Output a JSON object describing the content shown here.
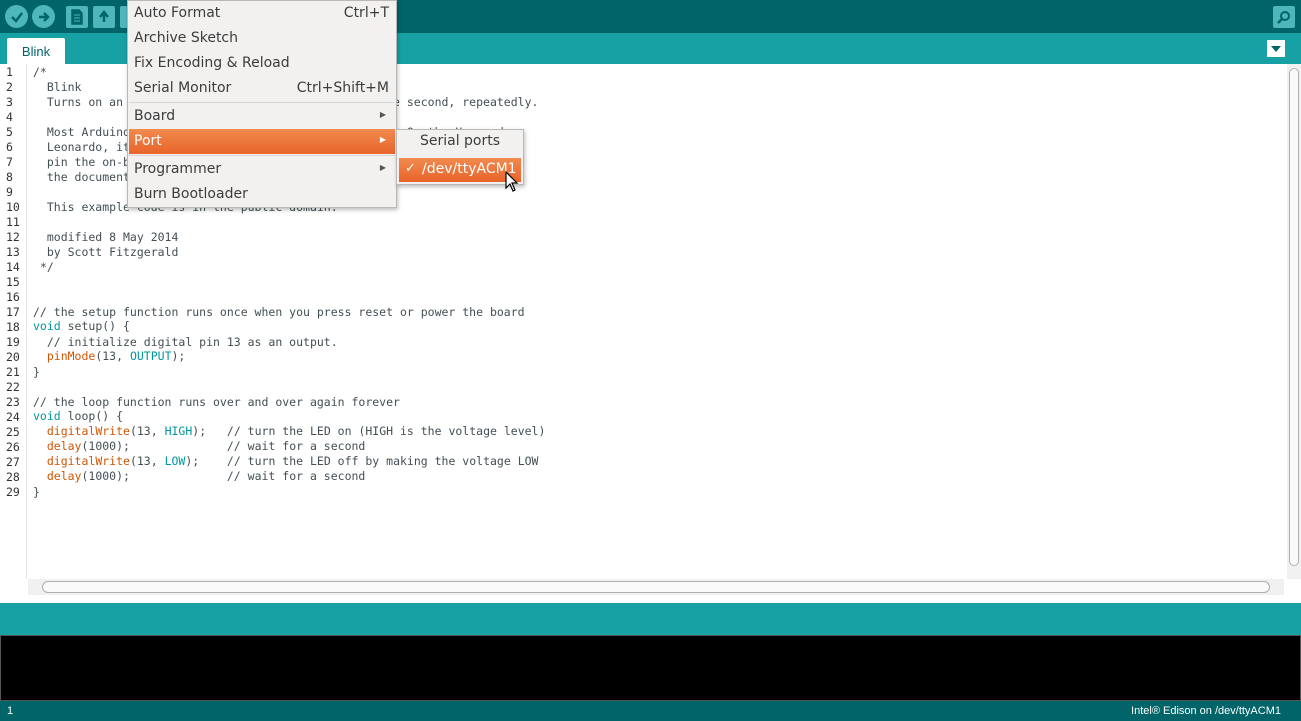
{
  "toolbar": {
    "buttons": [
      {
        "name": "verify",
        "icon": "check-icon"
      },
      {
        "name": "upload",
        "icon": "arrow-right-icon"
      },
      {
        "name": "new",
        "icon": "document-icon"
      },
      {
        "name": "open",
        "icon": "arrow-up-icon"
      }
    ],
    "right_button_icon": "serial-monitor-icon"
  },
  "tabs": [
    {
      "label": "Blink",
      "active": true
    }
  ],
  "menu": {
    "items": [
      {
        "label": "Auto Format",
        "shortcut": "Ctrl+T"
      },
      {
        "label": "Archive Sketch",
        "shortcut": ""
      },
      {
        "label": "Fix Encoding & Reload",
        "shortcut": ""
      },
      {
        "label": "Serial Monitor",
        "shortcut": "Ctrl+Shift+M"
      },
      {
        "label": "Board",
        "submenu": true
      },
      {
        "label": "Port",
        "submenu": true,
        "highlighted": true
      },
      {
        "label": "Programmer",
        "submenu": true
      },
      {
        "label": "Burn Bootloader",
        "shortcut": ""
      }
    ]
  },
  "port_submenu": {
    "header": "Serial ports",
    "selected": "/dev/ttyACM1",
    "check": "✓"
  },
  "editor": {
    "line_numbers": [
      "1",
      "2",
      "3",
      "4",
      "5",
      "6",
      "7",
      "8",
      "9",
      "10",
      "11",
      "12",
      "13",
      "14",
      "15",
      "16",
      "17",
      "18",
      "19",
      "20",
      "21",
      "22",
      "23",
      "24",
      "25",
      "26",
      "27",
      "28",
      "29"
    ],
    "code_lines": [
      "/*",
      "  Blink",
      "  Turns on an LED on for one second, then off for one second, repeatedly.",
      "",
      "  Most Arduinos have an on-board LED you can control. On the Uno and",
      "  Leonardo, it is attached to digital pin 13. If you're unsure what",
      "  pin the on-board LED is connected to on your Arduino model, check",
      "  the documentation at http://www.arduino.cc",
      "",
      "  This example code is in the public domain.",
      "",
      "  modified 8 May 2014",
      "  by Scott Fitzgerald",
      " */",
      "",
      "",
      "// the setup function runs once when you press reset or power the board",
      "",
      "  // initialize digital pin 13 as an output.",
      "",
      "}",
      "",
      "// the loop function runs over and over again forever",
      "",
      "",
      "",
      "",
      "",
      "}"
    ],
    "tokens": {
      "void": "void",
      "setup": " setup() {",
      "loop": " loop() {",
      "pinMode": "pinMode",
      "pinMode_args_a": "(13, ",
      "OUTPUT": "OUTPUT",
      "pinMode_args_b": ");",
      "digitalWrite": "digitalWrite",
      "dw_args_a": "(13, ",
      "HIGH": "HIGH",
      "dw1_rest": ");   // turn the LED on (HIGH is the voltage level)",
      "delay": "delay",
      "delay_rest": "(1000);              // wait for a second",
      "LOW": "LOW",
      "dw2_rest": ");    // turn the LED off by making the voltage LOW"
    }
  },
  "status": {
    "line": "1",
    "board": "Intel® Edison on /dev/ttyACM1"
  },
  "colors": {
    "toolbar": "#006468",
    "tabbar": "#17a1a5",
    "highlight": "#e8642b",
    "keyword": "#00979c",
    "function": "#d35400"
  }
}
